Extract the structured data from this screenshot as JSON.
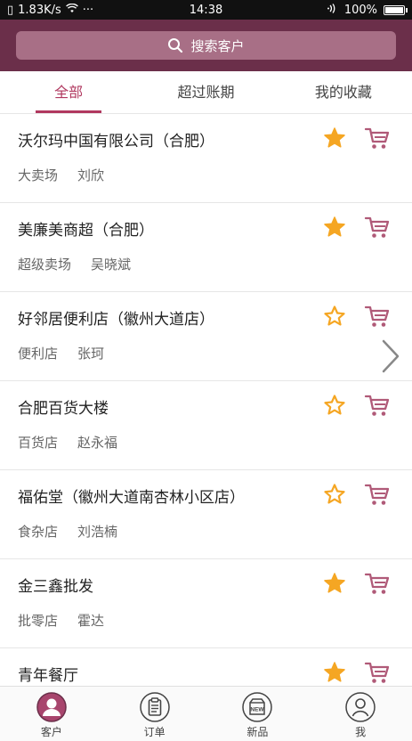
{
  "status_bar": {
    "network_speed": "1.83K/s",
    "dots": "···",
    "time": "14:38",
    "battery": "100%",
    "battery_level": 1.0
  },
  "search": {
    "placeholder": "搜索客户"
  },
  "tabs": [
    {
      "label": "全部",
      "active": true
    },
    {
      "label": "超过账期",
      "active": false
    },
    {
      "label": "我的收藏",
      "active": false
    }
  ],
  "customers": [
    {
      "name": "沃尔玛中国有限公司（合肥）",
      "type": "大卖场",
      "contact": "刘欣",
      "favorited": true
    },
    {
      "name": "美廉美商超（合肥）",
      "type": "超级卖场",
      "contact": "吴晓斌",
      "favorited": true
    },
    {
      "name": "好邻居便利店（徽州大道店）",
      "type": "便利店",
      "contact": "张珂",
      "favorited": false
    },
    {
      "name": "合肥百货大楼",
      "type": "百货店",
      "contact": "赵永福",
      "favorited": false
    },
    {
      "name": "福佑堂（徽州大道南杏林小区店）",
      "type": "食杂店",
      "contact": "刘浩楠",
      "favorited": false
    },
    {
      "name": "金三鑫批发",
      "type": "批零店",
      "contact": "霍达",
      "favorited": true
    },
    {
      "name": "青年餐厅",
      "type": "",
      "contact": "",
      "favorited": true
    }
  ],
  "bottom_nav": [
    {
      "label": "客户",
      "icon": "customer-icon",
      "active": true
    },
    {
      "label": "订单",
      "icon": "order-icon",
      "active": false
    },
    {
      "label": "新品",
      "icon": "new-product-icon",
      "active": false
    },
    {
      "label": "我",
      "icon": "profile-icon",
      "active": false
    }
  ],
  "colors": {
    "brand": "#6b2f4a",
    "accent": "#b0385f",
    "star": "#f5a623",
    "cart": "#b05a78"
  }
}
